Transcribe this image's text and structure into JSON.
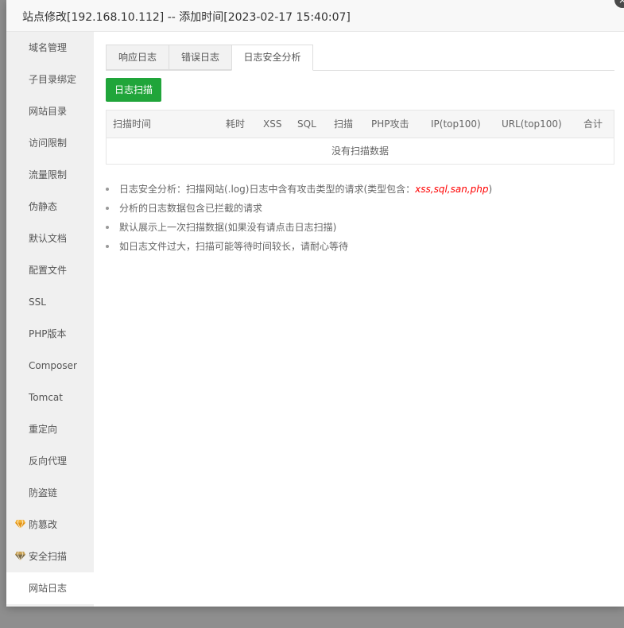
{
  "modal": {
    "title": "站点修改[192.168.10.112] -- 添加时间[2023-02-17 15:40:07]",
    "close_label": "×"
  },
  "sidebar": {
    "items": [
      {
        "label": "域名管理",
        "vip": false
      },
      {
        "label": "子目录绑定",
        "vip": false
      },
      {
        "label": "网站目录",
        "vip": false
      },
      {
        "label": "访问限制",
        "vip": false
      },
      {
        "label": "流量限制",
        "vip": false
      },
      {
        "label": "伪静态",
        "vip": false
      },
      {
        "label": "默认文档",
        "vip": false
      },
      {
        "label": "配置文件",
        "vip": false
      },
      {
        "label": "SSL",
        "vip": false
      },
      {
        "label": "PHP版本",
        "vip": false
      },
      {
        "label": "Composer",
        "vip": false
      },
      {
        "label": "Tomcat",
        "vip": false
      },
      {
        "label": "重定向",
        "vip": false
      },
      {
        "label": "反向代理",
        "vip": false
      },
      {
        "label": "防盗链",
        "vip": false
      },
      {
        "label": "防篡改",
        "vip": true
      },
      {
        "label": "安全扫描",
        "vip": true
      },
      {
        "label": "网站日志",
        "vip": false,
        "active": true
      }
    ],
    "vip_icon": "gem-icon",
    "vip_color": "#e8a33c"
  },
  "tabs": [
    {
      "label": "响应日志"
    },
    {
      "label": "错误日志"
    },
    {
      "label": "日志安全分析",
      "active": true
    }
  ],
  "scan_button": {
    "label": "日志扫描",
    "color": "#20a53a"
  },
  "table": {
    "columns": [
      "扫描时间",
      "耗时",
      "XSS",
      "SQL",
      "扫描",
      "PHP攻击",
      "IP(top100)",
      "URL(top100)",
      "合计"
    ],
    "empty_text": "没有扫描数据"
  },
  "notes": {
    "n1_prefix": "日志安全分析：扫描网站(.log)日志中含有攻击类型的请求(类型包含：",
    "n1_highlight": "xss,sql,san,php",
    "n1_suffix": ")",
    "n2": "分析的日志数据包含已拦截的请求",
    "n3": "默认展示上一次扫描数据(如果没有请点击日志扫描)",
    "n4": "如日志文件过大，扫描可能等待时间较长，请耐心等待",
    "highlight_color": "#ff0000"
  }
}
